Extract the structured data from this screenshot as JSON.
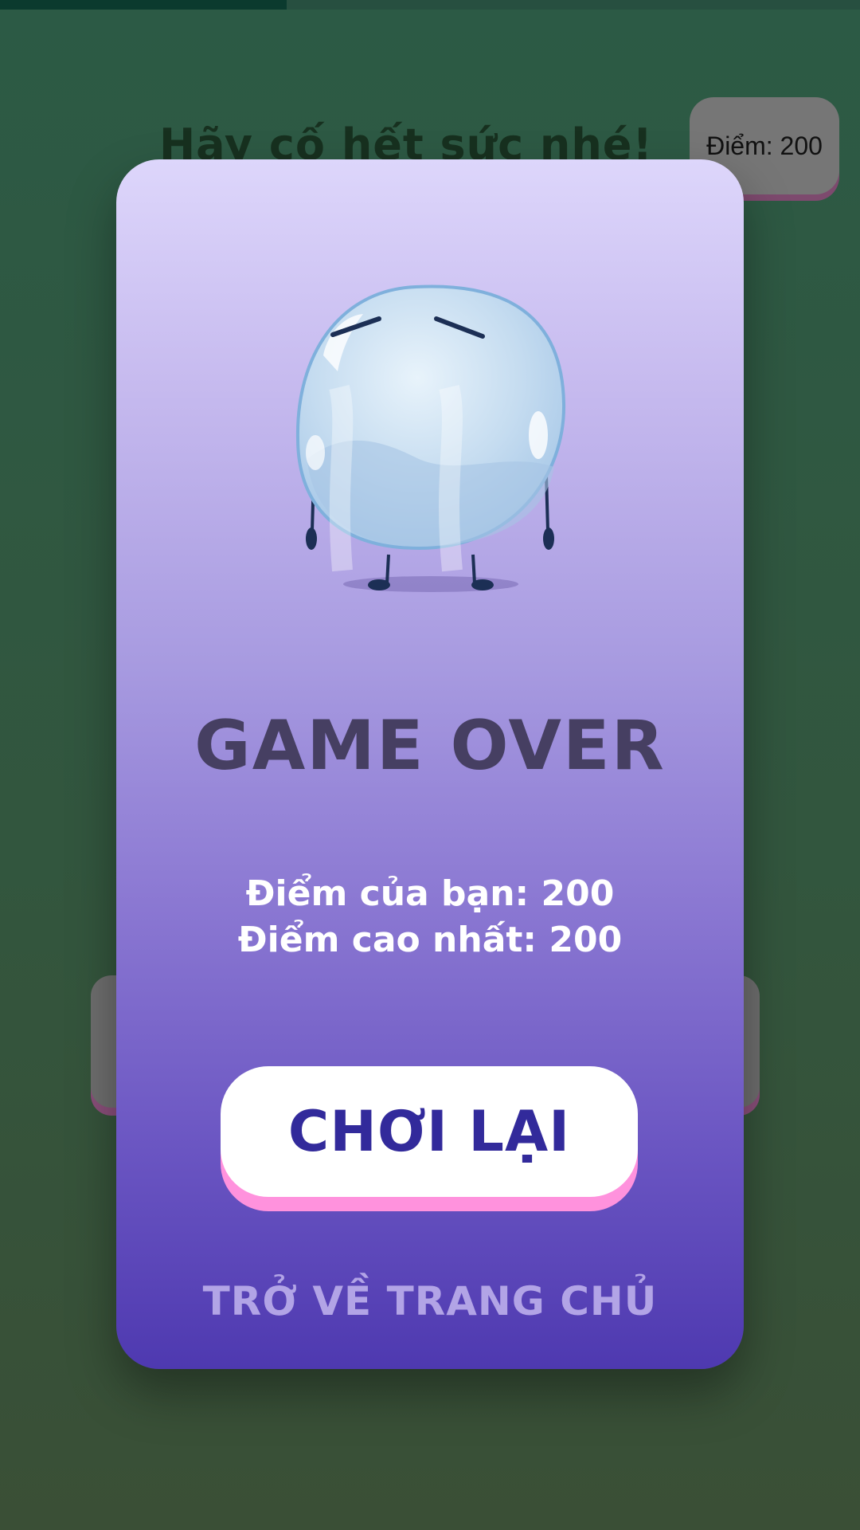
{
  "progress": {
    "fraction": 0.333,
    "fill_color": "#0b3a2e"
  },
  "background": {
    "title": "Hãy cố hết sức nhé!",
    "score_chip": "Điểm: 200"
  },
  "modal": {
    "mascot_icon": "sad-bubble-icon",
    "title": "GAME OVER",
    "your_score_line": "Điểm của bạn: 200",
    "high_score_line": "Điểm cao nhất: 200",
    "replay_label": "CHƠI LẠI",
    "home_label": "TRỞ VỀ TRANG CHỦ"
  },
  "colors": {
    "accent_text": "#322a9b",
    "button_shadow": "#ff92dd",
    "title_color": "#463f62"
  }
}
